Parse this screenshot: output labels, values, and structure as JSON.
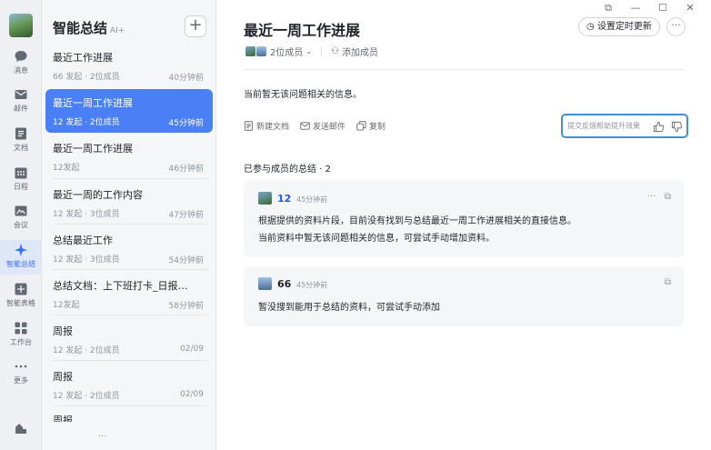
{
  "rail": {
    "items": [
      {
        "label": "消息"
      },
      {
        "label": "邮件"
      },
      {
        "label": "文档"
      },
      {
        "label": "日程"
      },
      {
        "label": "会议"
      },
      {
        "label": "智能总结"
      },
      {
        "label": "智能表格"
      },
      {
        "label": "工作台"
      },
      {
        "label": "更多"
      }
    ],
    "active_index": 5,
    "accent": "#3370ff"
  },
  "list": {
    "title": "智能总结",
    "ai_badge": "AI+",
    "items": [
      {
        "title": "最近工作进展",
        "meta": "66 发起 · 2位成员",
        "time": "40分钟前"
      },
      {
        "title": "最近一周工作进展",
        "meta": "12 发起 · 2位成员",
        "time": "45分钟前"
      },
      {
        "title": "最近一周工作进展",
        "meta": "12发起",
        "time": "46分钟前"
      },
      {
        "title": "最近一周的工作内容",
        "meta": "12 发起 · 3位成员",
        "time": "47分钟前"
      },
      {
        "title": "总结最近工作",
        "meta": "12 发起 · 3位成员",
        "time": "54分钟前"
      },
      {
        "title": "总结文档：上下班打卡_日报_20...",
        "meta": "12发起",
        "time": "58分钟前"
      },
      {
        "title": "周报",
        "meta": "12 发起 · 2位成员",
        "time": "02/09"
      },
      {
        "title": "周报",
        "meta": "12 发起 · 2位成员",
        "time": "02/09"
      }
    ],
    "partial_item": "周报",
    "more": "···"
  },
  "main": {
    "title": "最近一周工作进展",
    "timer_button": "设置定时更新",
    "member_count": "2位成员",
    "add_member": "添加成员",
    "notice": "当前暂无该问题相关的信息。",
    "actions": {
      "new_doc": "新建文档",
      "send_mail": "发送邮件",
      "copy": "复制"
    },
    "feedback_placeholder": "提交反馈帮助提升效果",
    "section_title": "已参与成员的总结 · 2",
    "cards": [
      {
        "name": "12",
        "time": "45分钟前",
        "lines": [
          "根据提供的资料片段，目前没有找到与总结最近一周工作进展相关的直接信息。",
          "当前资料中暂无该问题相关的信息，可尝试手动增加资料。"
        ]
      },
      {
        "name": "66",
        "time": "45分钟前",
        "lines": [
          "暂没搜到能用于总结的资料，可尝试手动添加"
        ]
      }
    ]
  }
}
